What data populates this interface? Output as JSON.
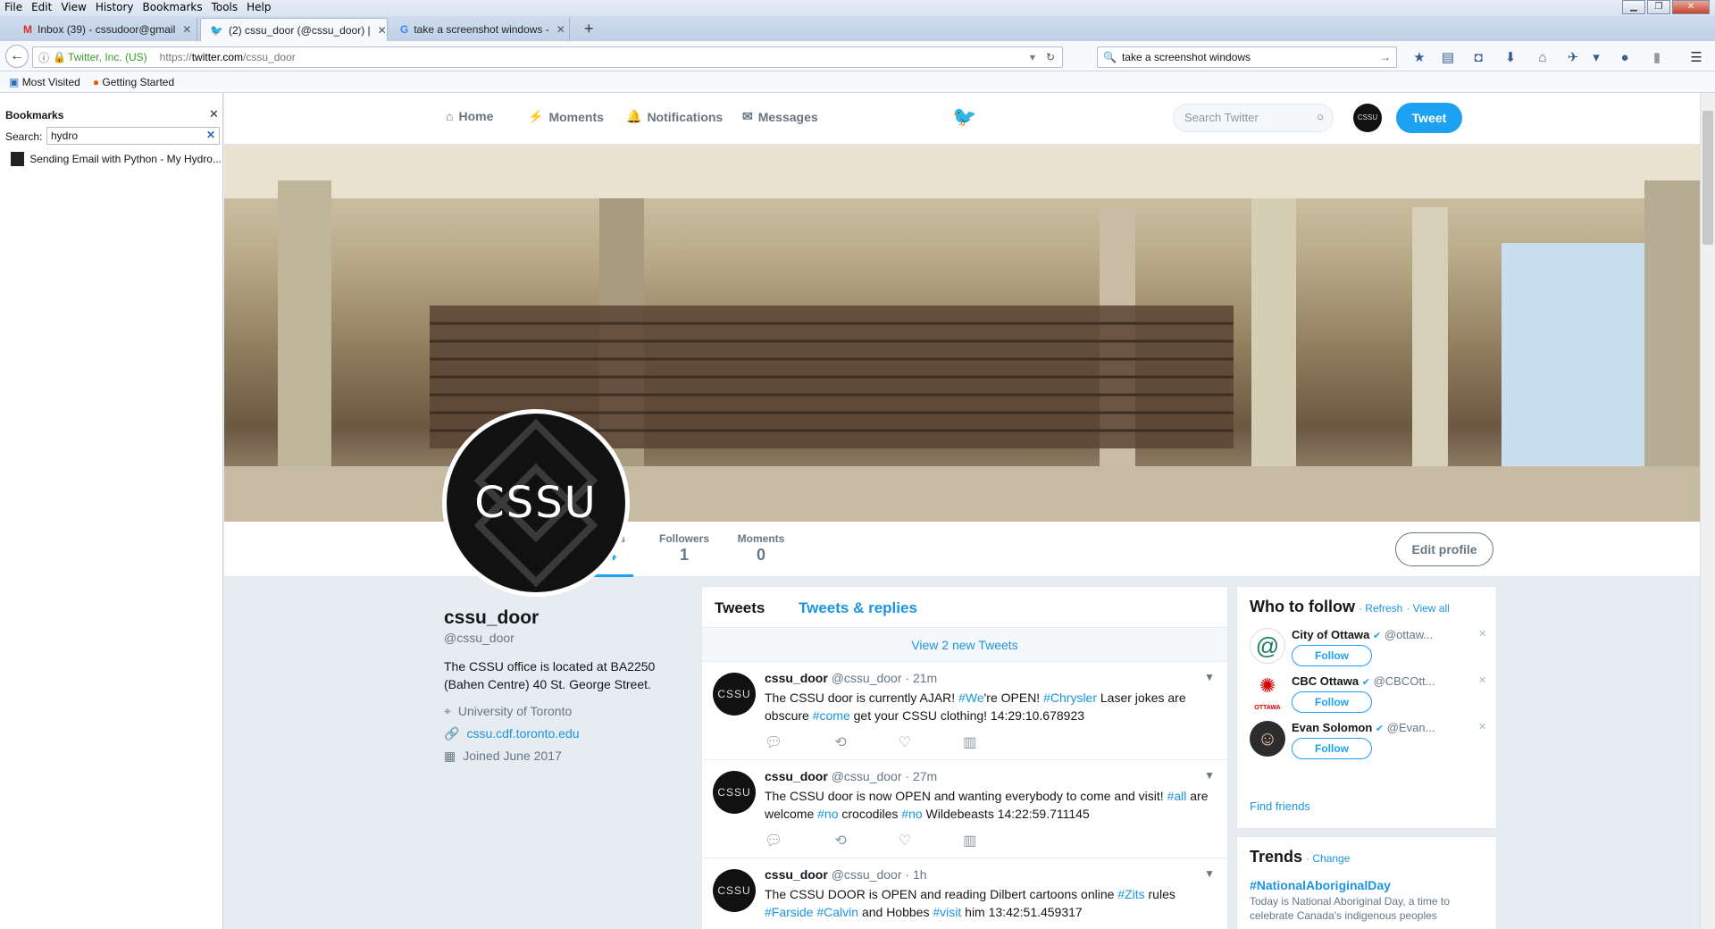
{
  "menu": [
    "File",
    "Edit",
    "View",
    "History",
    "Bookmarks",
    "Tools",
    "Help"
  ],
  "tabs": [
    {
      "title": "Inbox (39) - cssudoor@gmail",
      "icon": "gmail-icon"
    },
    {
      "title": "(2) cssu_door (@cssu_door) |",
      "icon": "twitter-bird-icon"
    },
    {
      "title": "take a screenshot windows -",
      "icon": "google-icon"
    }
  ],
  "nav": {
    "identity": "Twitter, Inc. (US)",
    "url_prefix": "https://",
    "url_host": "twitter.com",
    "url_path": "/cssu_door",
    "search_value": "take a screenshot windows"
  },
  "bookmarks_bar": [
    "Most Visited",
    "Getting Started"
  ],
  "sidebar": {
    "title": "Bookmarks",
    "search_label": "Search:",
    "search_value": "hydro",
    "results": [
      "Sending Email with Python - My Hydro..."
    ]
  },
  "twitter_nav": {
    "home": "Home",
    "moments": "Moments",
    "notifications": "Notifications",
    "messages": "Messages",
    "search_placeholder": "Search Twitter",
    "avatar_text": "CSSU",
    "tweet_button": "Tweet"
  },
  "stats": [
    {
      "label": "Tweets",
      "value": "44"
    },
    {
      "label": "Followers",
      "value": "1"
    },
    {
      "label": "Moments",
      "value": "0"
    }
  ],
  "edit_profile": "Edit profile",
  "profile": {
    "avatar_text": "CSSU",
    "name": "cssu_door",
    "handle": "@cssu_door",
    "bio": "The CSSU office is located at BA2250 (Bahen Centre) 40 St. George Street.",
    "location": "University of Toronto",
    "website": "cssu.cdf.toronto.edu",
    "joined": "Joined June 2017"
  },
  "timeline": {
    "tab_tweets": "Tweets",
    "tab_replies": "Tweets & replies",
    "new_tweets": "View 2 new Tweets",
    "tweets": [
      {
        "name": "cssu_door",
        "handle": "@cssu_door",
        "time": "· 21m",
        "avatar": "CSSU",
        "parts": [
          [
            "The CSSU door is currently AJAR!  ",
            false
          ],
          [
            "#We",
            true
          ],
          [
            "'re OPEN! ",
            false
          ],
          [
            "#Chrysler",
            true
          ],
          [
            " Laser jokes are obscure ",
            false
          ],
          [
            "#come",
            true
          ],
          [
            " get your CSSU clothing!  14:29:10.678923",
            false
          ]
        ]
      },
      {
        "name": "cssu_door",
        "handle": "@cssu_door",
        "time": "· 27m",
        "avatar": "CSSU",
        "parts": [
          [
            "The CSSU door is now OPEN and wanting everybody to come and visit!  ",
            false
          ],
          [
            "#all",
            true
          ],
          [
            " are welcome ",
            false
          ],
          [
            "#no",
            true
          ],
          [
            " crocodiles ",
            false
          ],
          [
            "#no",
            true
          ],
          [
            " Wildebeasts 14:22:59.711145",
            false
          ]
        ]
      },
      {
        "name": "cssu_door",
        "handle": "@cssu_door",
        "time": "· 1h",
        "avatar": "CSSU",
        "parts": [
          [
            "The CSSU DOOR is OPEN and reading Dilbert cartoons online ",
            false
          ],
          [
            "#Zits",
            true
          ],
          [
            " rules ",
            false
          ],
          [
            "#Farside",
            true
          ],
          [
            " ",
            false
          ],
          [
            "#Calvin",
            true
          ],
          [
            " and Hobbes ",
            false
          ],
          [
            "#visit",
            true
          ],
          [
            " him 13:42:51.459317",
            false
          ]
        ]
      }
    ]
  },
  "who_to_follow": {
    "title": "Who to follow",
    "refresh": "· Refresh",
    "view_all": "· View all",
    "follow_label": "Follow",
    "find_friends": "Find friends",
    "accounts": [
      {
        "name": "City of Ottawa",
        "handle": "@ottaw...",
        "icon": "city-of-ottawa-logo-icon"
      },
      {
        "name": "CBC Ottawa",
        "handle": "@CBCOtt...",
        "icon": "cbc-ottawa-logo-icon",
        "logo_caption": "OTTAWA"
      },
      {
        "name": "Evan Solomon",
        "handle": "@Evan...",
        "icon": "person-avatar-icon"
      }
    ]
  },
  "trends": {
    "title": "Trends",
    "change": "· Change",
    "items": [
      {
        "tag": "#NationalAboriginalDay",
        "desc": "Today is National Aboriginal Day, a time to celebrate Canada's indigenous peoples"
      }
    ]
  },
  "colors": {
    "twitter_blue": "#1da1f2",
    "link": "#1b95e0",
    "page_bg": "#e6ecf0"
  }
}
